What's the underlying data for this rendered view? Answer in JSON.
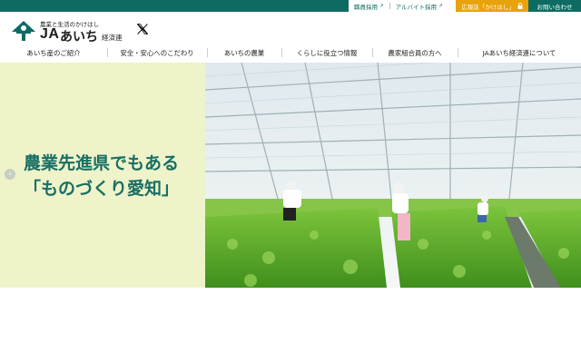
{
  "utility": {
    "links": [
      {
        "label": "職員採用",
        "icon": "external-link-icon"
      },
      {
        "label": "アルバイト採用",
        "icon": "external-link-icon"
      }
    ],
    "pr_label": "広報誌「かけはし」",
    "pr_icon": "lock-icon",
    "contact_label": "お問い合わせ"
  },
  "logo": {
    "tagline": "農業と生活のかけはし",
    "ja": "JA",
    "aichi": "あいち",
    "suffix": "経済連"
  },
  "social": {
    "icon": "x-twitter-icon"
  },
  "nav": {
    "items": [
      "あいち産のご紹介",
      "安全・安心へのこだわり",
      "あいちの農業",
      "くらしに役立つ情報",
      "農家組合員の方へ",
      "JAあいち経済連について"
    ]
  },
  "hero": {
    "line1": "農業先進県でもある",
    "line2": "「ものづくり愛知」",
    "prev_icon": "chevron-left-icon"
  },
  "colors": {
    "brand_green": "#0e6b62",
    "accent_orange": "#e8a20b",
    "hero_panel": "#eef3c9",
    "hero_text": "#1a6e64"
  }
}
